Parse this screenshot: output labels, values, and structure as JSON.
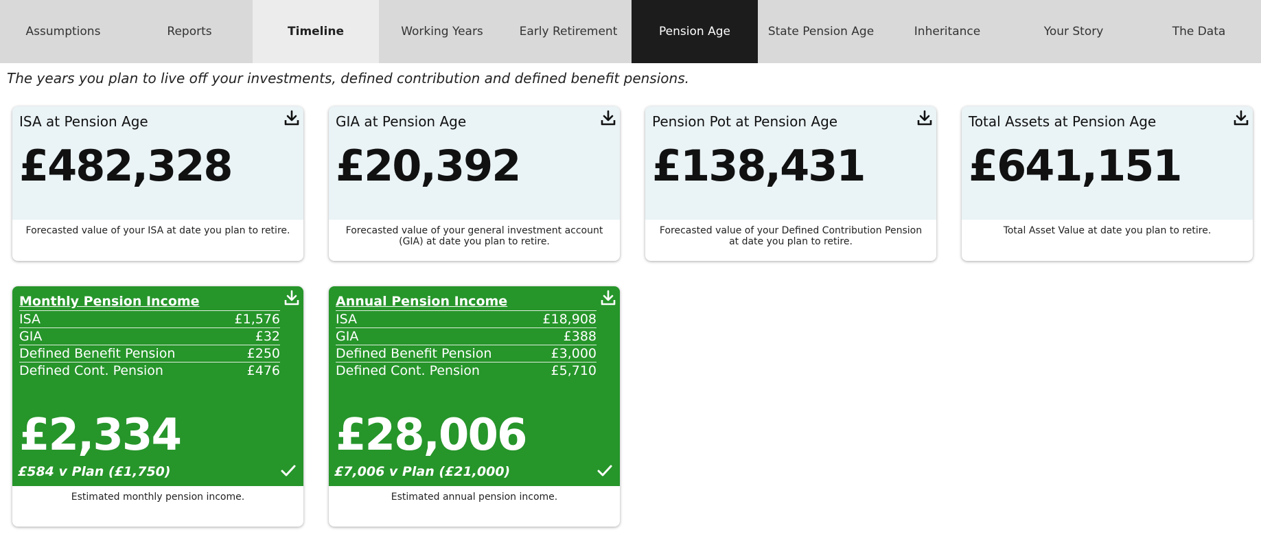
{
  "tabs": [
    {
      "label": "Assumptions",
      "state": "normal"
    },
    {
      "label": "Reports",
      "state": "normal"
    },
    {
      "label": "Timeline",
      "state": "hover"
    },
    {
      "label": "Working Years",
      "state": "normal"
    },
    {
      "label": "Early Retirement",
      "state": "normal"
    },
    {
      "label": "Pension Age",
      "state": "active"
    },
    {
      "label": "State Pension Age",
      "state": "normal"
    },
    {
      "label": "Inheritance",
      "state": "normal"
    },
    {
      "label": "Your Story",
      "state": "normal"
    },
    {
      "label": "The Data",
      "state": "normal"
    }
  ],
  "subtitle": "The years you plan to live off your investments, defined contribution and defined benefit pensions.",
  "cards": [
    {
      "title": "ISA at Pension Age",
      "value": "£482,328",
      "caption": "Forecasted value of your ISA at date you plan to retire."
    },
    {
      "title": "GIA at Pension Age",
      "value": "£20,392",
      "caption": "Forecasted value of your general investment account (GIA) at date you plan to retire."
    },
    {
      "title": "Pension Pot at Pension Age",
      "value": "£138,431",
      "caption": "Forecasted value of your Defined Contribution Pension at date you plan to retire."
    },
    {
      "title": "Total Assets at Pension Age",
      "value": "£641,151",
      "caption": "Total Asset Value at date you plan to retire."
    }
  ],
  "income_cards": [
    {
      "title": "Monthly Pension Income",
      "rows": [
        {
          "label": "ISA",
          "value": "£1,576"
        },
        {
          "label": "GIA",
          "value": "£32"
        },
        {
          "label": "Defined Benefit Pension",
          "value": "£250"
        },
        {
          "label": "Defined Cont. Pension",
          "value": "£476"
        }
      ],
      "total": "£2,334",
      "vs_plan": "£584 v Plan (£1,750)",
      "caption": "Estimated monthly pension income."
    },
    {
      "title": "Annual Pension Income",
      "rows": [
        {
          "label": "ISA",
          "value": "£18,908"
        },
        {
          "label": "GIA",
          "value": "£388"
        },
        {
          "label": "Defined Benefit Pension",
          "value": "£3,000"
        },
        {
          "label": "Defined Cont. Pension",
          "value": "£5,710"
        }
      ],
      "total": "£28,006",
      "vs_plan": "£7,006 v Plan (£21,000)",
      "caption": "Estimated annual pension income."
    }
  ],
  "icons": {
    "download": "download-icon",
    "check": "check-icon"
  },
  "colors": {
    "tab_bar": "#d9d9d9",
    "tab_active": "#1c1c1c",
    "card_panel": "#eaf3f6",
    "income_green": "#26952a"
  }
}
